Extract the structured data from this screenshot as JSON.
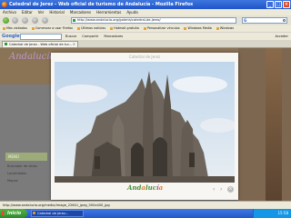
{
  "window": {
    "title": "Catedral de Jerez - Web oficial de turismo de Andalucía - Mozilla Firefox"
  },
  "menu": [
    "Archivo",
    "Editar",
    "Ver",
    "Historial",
    "Marcadores",
    "Herramientas",
    "Ayuda"
  ],
  "nav": {
    "url": "http://www.andalucia.org/galeria/catedral-de-jerez/"
  },
  "bookmarks": [
    "Más visitados",
    "Comenzar a usar Firefox",
    "Últimas noticias",
    "Hotmail gratuito",
    "Personalizar vínculos",
    "Windows Media",
    "Windows"
  ],
  "google_toolbar": {
    "logo": "Google",
    "buttons": [
      "Buscar",
      "Compartir",
      "Marcadores"
    ],
    "right": [
      "Acceder"
    ]
  },
  "tab": {
    "label": "Catedral de Jerez - Web oficial de tur..."
  },
  "page": {
    "logo": "Andalucía",
    "menu_head": "MENÚ",
    "menu_items": [
      "Buscador de sitios",
      "Localidades",
      "Mapas"
    ]
  },
  "lightbox": {
    "caption": "Catedral de Jerez",
    "brand_parts": [
      "And",
      "a",
      "luc",
      "í",
      "a"
    ],
    "prev": "‹",
    "next": "›",
    "close": "×"
  },
  "status": {
    "text": "http://www.andalucia.org/media/image_22641_jpeg_500x400_jpg"
  },
  "taskbar": {
    "start": "Inicio",
    "task": "Catedral de Jerez...",
    "clock": "15:58"
  },
  "colors": {
    "titlebar": "#2b5fd6",
    "page_bg": "#6c6c6c",
    "brand_green": "#4a8d3a",
    "brand_orange": "#e07a1e",
    "brand_purple": "#b04a9a"
  }
}
